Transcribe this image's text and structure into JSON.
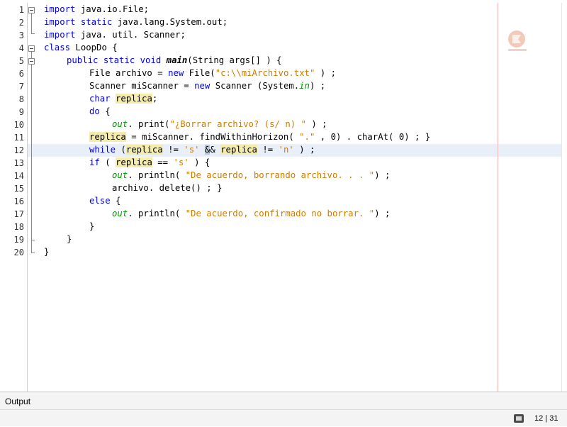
{
  "editor": {
    "line_numbers": [
      "1",
      "2",
      "3",
      "4",
      "5",
      "6",
      "7",
      "8",
      "9",
      "10",
      "11",
      "12",
      "13",
      "14",
      "15",
      "16",
      "17",
      "18",
      "19",
      "20"
    ]
  },
  "code": {
    "l1": {
      "kw": "import",
      "rest": " java.io.File;"
    },
    "l2": {
      "kw": "import static",
      "rest": " java.lang.System.out;"
    },
    "l3": {
      "kw": "import",
      "rest": " java. util. Scanner;"
    },
    "l4": {
      "kw": "class",
      "rest": " LoopDo {"
    },
    "l5": {
      "kw": "public static void",
      "sp": " ",
      "mth": "main",
      "rest": "(String args[] ) {"
    },
    "l6": {
      "a": "File archivo = ",
      "kw": "new",
      "b": " File(",
      "str": "\"c:\\\\miArchivo.txt\"",
      "c": " ) ;"
    },
    "l7": {
      "a": "Scanner miScanner = ",
      "kw": "new",
      "b": " Scanner (System.",
      "fld": "in",
      "c": ") ;"
    },
    "l8": {
      "kw": "char",
      "sp": " ",
      "var": "replica",
      "rest": ";"
    },
    "l9": {
      "kw": "do",
      "rest": " {"
    },
    "l10": {
      "fld": "out",
      "a": ". print(",
      "str": "\"¿Borrar archivo? (s/ n) \"",
      "b": " ) ;"
    },
    "l11": {
      "var": "replica",
      "a": " = miScanner. findWithinHorizon( ",
      "str": "\".\"",
      "b": " , 0) . charAt( 0) ; }"
    },
    "l12": {
      "kw": "while",
      "a": " (",
      "var": "replica",
      "b": " != ",
      "str1": "'s'",
      "c": " ",
      "caret": "&",
      "d": "& ",
      "var2": "replica",
      "e": " != ",
      "str2": "'n'",
      "f": " ) ;"
    },
    "l13": {
      "kw": "if",
      "a": " ( ",
      "var": "replica",
      "b": " == ",
      "str": "'s'",
      "c": " ) {"
    },
    "l14": {
      "fld": "out",
      "a": ". println( ",
      "str": "\"De acuerdo, borrando archivo. . . \"",
      "b": ") ;"
    },
    "l15": {
      "text": "archivo. delete() ; }"
    },
    "l16": {
      "kw": "else",
      "rest": " {"
    },
    "l17": {
      "fld": "out",
      "a": ". println( ",
      "str": "\"De acuerdo, confirmado no borrar. \"",
      "b": ") ;"
    },
    "l18": {
      "text": "}"
    },
    "l19": {
      "text": "}"
    },
    "l20": {
      "text": "}"
    }
  },
  "bottom": {
    "output_tab": "Output",
    "cursor_position": "12 | 31"
  },
  "colors": {
    "keyword": "#0000e6",
    "string": "#ce7b00",
    "field": "#009900",
    "occurrence_highlight": "#f4ecaa",
    "current_line": "#e9eff8"
  }
}
